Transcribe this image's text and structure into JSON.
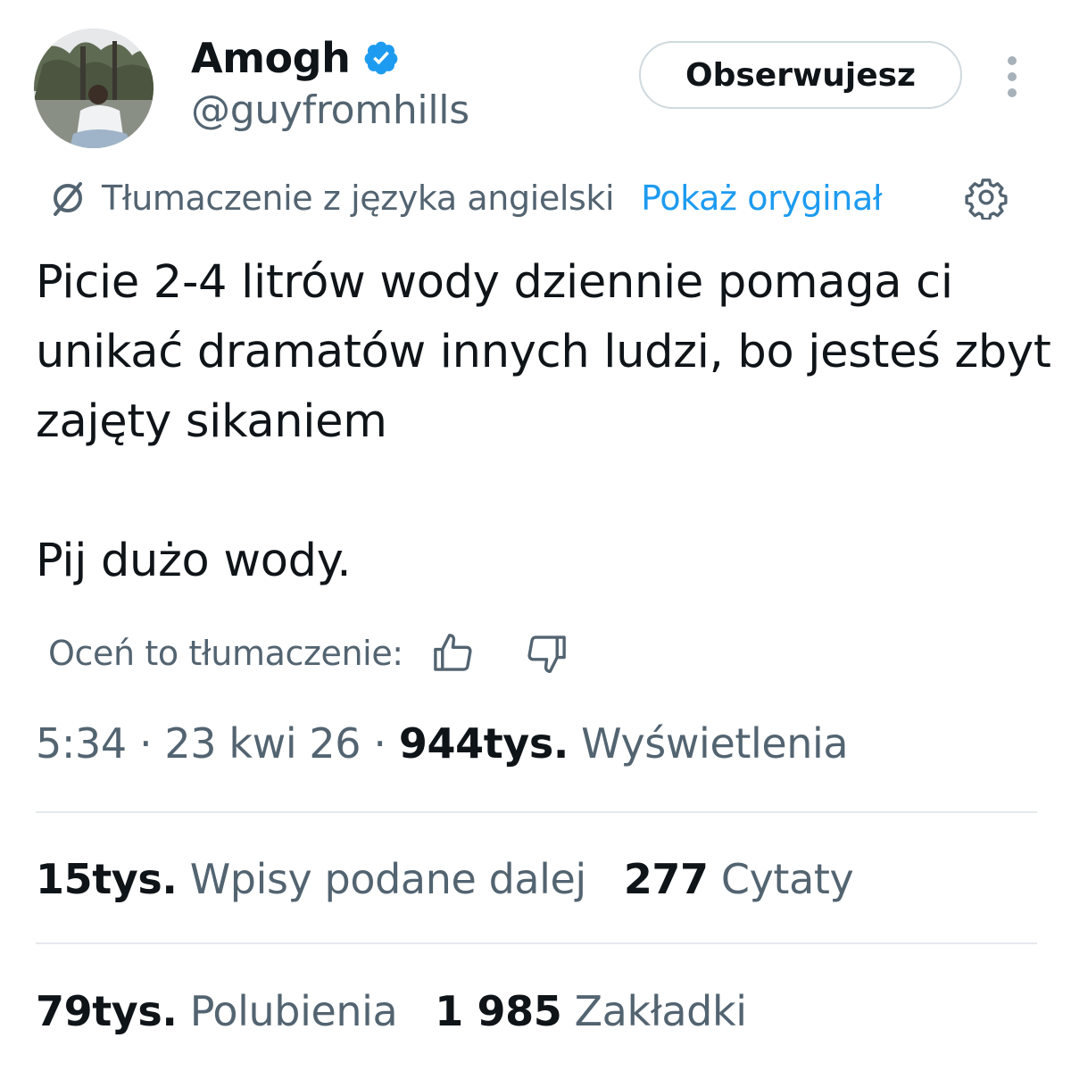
{
  "author": {
    "display_name": "Amogh",
    "handle": "@guyfromhills",
    "verified_icon": "verified-badge-icon",
    "verified_color": "#1d9bf0"
  },
  "header": {
    "follow_label": "Obserwujesz",
    "more_icon": "more-vertical-icon"
  },
  "translation": {
    "icon": "translate-icon",
    "label": "Tłumaczenie z języka angielski",
    "show_original": "Pokaż oryginał",
    "settings_icon": "gear-icon",
    "link_color": "#1d9bf0"
  },
  "tweet": {
    "paragraphs": [
      "Picie 2-4 litrów wody dziennie pomaga ci unikać dramatów innych ludzi, bo jesteś zbyt zajęty sikaniem",
      "Pij dużo wody."
    ]
  },
  "rating": {
    "label": "Oceń to tłumaczenie:",
    "thumbs_up_icon": "thumbs-up-icon",
    "thumbs_down_icon": "thumbs-down-icon"
  },
  "meta": {
    "time": "5:34",
    "separator": "·",
    "date": "23 kwi 26",
    "views_count": "944tys.",
    "views_label": "Wyświetlenia"
  },
  "stats": {
    "reposts": {
      "count": "15tys.",
      "label": "Wpisy podane dalej"
    },
    "quotes": {
      "count": "277",
      "label": "Cytaty"
    },
    "likes": {
      "count": "79tys.",
      "label": "Polubienia"
    },
    "bookmarks": {
      "count": "1 985",
      "label": "Zakładki"
    }
  },
  "colors": {
    "text_primary": "#0f1419",
    "text_secondary": "#536471",
    "divider": "#e5e9ec"
  }
}
